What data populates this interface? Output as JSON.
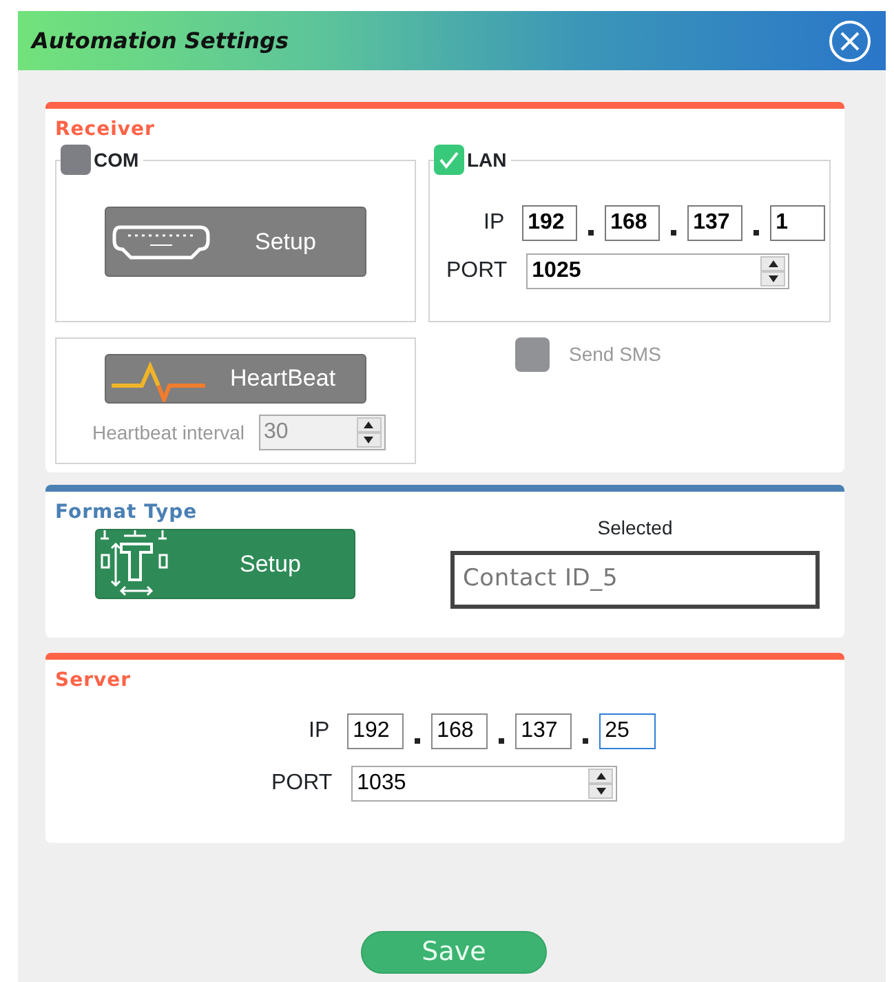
{
  "window": {
    "title": "Automation Settings"
  },
  "receiver": {
    "title": "Receiver",
    "com": {
      "label": "COM",
      "checked": false,
      "setup_button": "Setup"
    },
    "lan": {
      "label": "LAN",
      "checked": true,
      "ip_label": "IP",
      "ip": [
        {
          "value": "192",
          "focused": false
        },
        {
          "value": "168",
          "focused": false
        },
        {
          "value": "137",
          "focused": false
        },
        {
          "value": "1",
          "focused": false
        }
      ],
      "port_label": "PORT",
      "port": "1025"
    },
    "heartbeat": {
      "button": "HeartBeat",
      "interval_label": "Heartbeat interval",
      "interval": "30",
      "disabled": true
    },
    "send_sms": {
      "label": "Send SMS",
      "checked": false,
      "disabled": true
    }
  },
  "format_type": {
    "title": "Format Type",
    "setup_button": "Setup",
    "selected_label": "Selected",
    "selected_value": "Contact ID_5"
  },
  "server": {
    "title": "Server",
    "ip_label": "IP",
    "ip": [
      {
        "value": "192",
        "focused": false
      },
      {
        "value": "168",
        "focused": false
      },
      {
        "value": "137",
        "focused": false
      },
      {
        "value": "25",
        "focused": true
      }
    ],
    "port_label": "PORT",
    "port": "1035"
  },
  "save_button": "Save"
}
